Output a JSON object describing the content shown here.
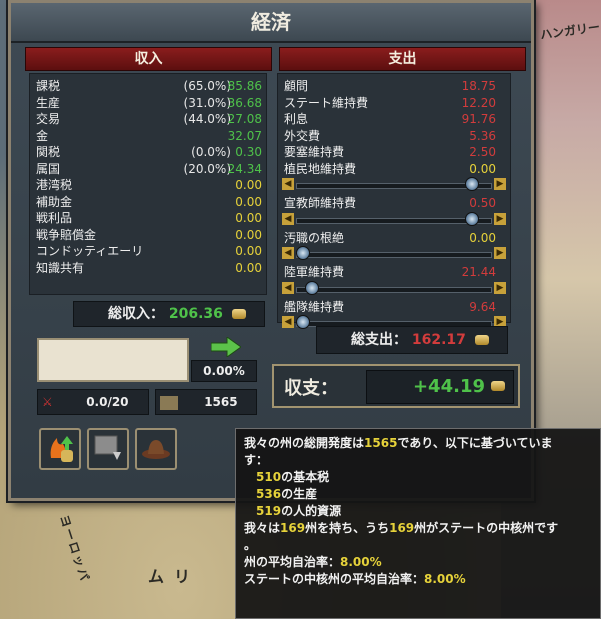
{
  "map": {
    "label_top_right": "ハンガリー",
    "label_left": "ヨーロッパ",
    "label_bottom": "ムリ"
  },
  "window": {
    "title": "経済"
  },
  "income": {
    "header": "収入",
    "rows": [
      {
        "label": "課税",
        "pct": "(65.0%)",
        "value": "85.86",
        "color": "green"
      },
      {
        "label": "生産",
        "pct": "(31.0%)",
        "value": "36.68",
        "color": "green"
      },
      {
        "label": "交易",
        "pct": "(44.0%)",
        "value": "27.08",
        "color": "green"
      },
      {
        "label": "金",
        "pct": "",
        "value": "32.07",
        "color": "green"
      },
      {
        "label": "関税",
        "pct": "(0.0%)",
        "value": "0.30",
        "color": "green"
      },
      {
        "label": "属国",
        "pct": "(20.0%)",
        "value": "24.34",
        "color": "green"
      },
      {
        "label": "港湾税",
        "pct": "",
        "value": "0.00",
        "color": "yellow"
      },
      {
        "label": "補助金",
        "pct": "",
        "value": "0.00",
        "color": "yellow"
      },
      {
        "label": "戦利品",
        "pct": "",
        "value": "0.00",
        "color": "yellow"
      },
      {
        "label": "戦争賠償金",
        "pct": "",
        "value": "0.00",
        "color": "yellow"
      },
      {
        "label": "コンドッティエーリ",
        "pct": "",
        "value": "0.00",
        "color": "yellow"
      },
      {
        "label": "知識共有",
        "pct": "",
        "value": "0.00",
        "color": "yellow"
      }
    ],
    "total_label": "総収入：",
    "total_value": "206.36"
  },
  "expense": {
    "header": "支出",
    "rows_top": [
      {
        "label": "顧問",
        "value": "18.75",
        "color": "red"
      },
      {
        "label": "ステート維持費",
        "value": "12.20",
        "color": "red"
      },
      {
        "label": "利息",
        "value": "91.76",
        "color": "red"
      },
      {
        "label": "外交費",
        "value": "5.36",
        "color": "red"
      },
      {
        "label": "要塞維持費",
        "value": "2.50",
        "color": "red"
      }
    ],
    "rows_slider": [
      {
        "label": "植民地維持費",
        "value": "0.00",
        "color": "yellow",
        "knob": 0.92
      },
      {
        "label": "宣教師維持費",
        "value": "0.50",
        "color": "red",
        "knob": 0.92
      },
      {
        "label": "汚職の根絶",
        "value": "0.00",
        "color": "yellow",
        "knob": 0.0
      },
      {
        "label": "陸軍維持費",
        "value": "21.44",
        "color": "red",
        "knob": 0.05
      },
      {
        "label": "艦隊維持費",
        "value": "9.64",
        "color": "red",
        "knob": 0.0
      }
    ],
    "total_label": "総支出：",
    "total_value": "162.17"
  },
  "balance": {
    "label": "収支：",
    "value": "+44.19"
  },
  "misc": {
    "loan_pct": "0.00%",
    "army_count": "0.0/20",
    "development": "1565"
  },
  "tooltip": {
    "line1_a": "我々の州の総開発度は",
    "line1_num": "1565",
    "line1_b": "であり、以下に基づいていま",
    "line2": "す：",
    "item1_num": "510",
    "item1_txt": "の基本税",
    "item2_num": "536",
    "item2_txt": "の生産",
    "item3_num": "519",
    "item3_txt": "の人的資源",
    "line6_a": "我々は",
    "line6_num1": "169",
    "line6_b": "州を持ち、うち",
    "line6_num2": "169",
    "line6_c": "州がステートの中核州です",
    "line7": "。",
    "line8_a": "州の平均自治率：",
    "line8_num": "8.00%",
    "line9_a": "ステートの中核州の平均自治率：",
    "line9_num": "8.00%"
  },
  "colors": {
    "green": "#4fc24a",
    "yellow": "#e6d23a",
    "red": "#d23c3c"
  }
}
